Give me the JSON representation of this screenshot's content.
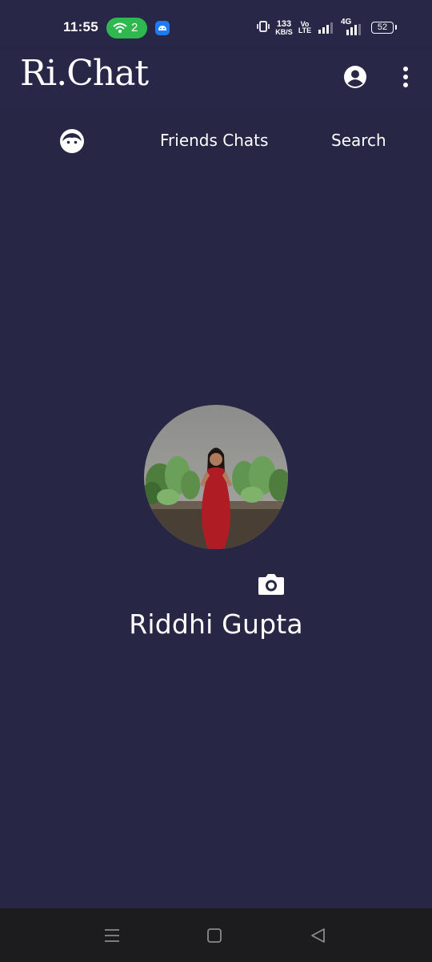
{
  "status_bar": {
    "time": "11:55",
    "hotspot_count": "2",
    "net_speed_value": "133",
    "net_speed_unit": "KB/S",
    "volte_top": "Vo",
    "volte_bottom": "LTE",
    "network_type": "4G",
    "battery": "52"
  },
  "app_bar": {
    "title": "Ri.Chat",
    "profile_icon": "account-circle-icon",
    "menu_icon": "more-vert-icon"
  },
  "tabs": {
    "profile_tab_icon": "face-icon",
    "friends_chats": "Friends Chats",
    "search": "Search"
  },
  "profile": {
    "name": "Riddhi Gupta",
    "camera_icon": "camera-icon"
  },
  "colors": {
    "background": "#282645",
    "app_bar": "#292747",
    "accent_green": "#2fb84f",
    "nav_bar": "#1c1c1e"
  },
  "nav": {
    "recents_icon": "menu-lines-icon",
    "home_icon": "square-icon",
    "back_icon": "triangle-back-icon"
  }
}
